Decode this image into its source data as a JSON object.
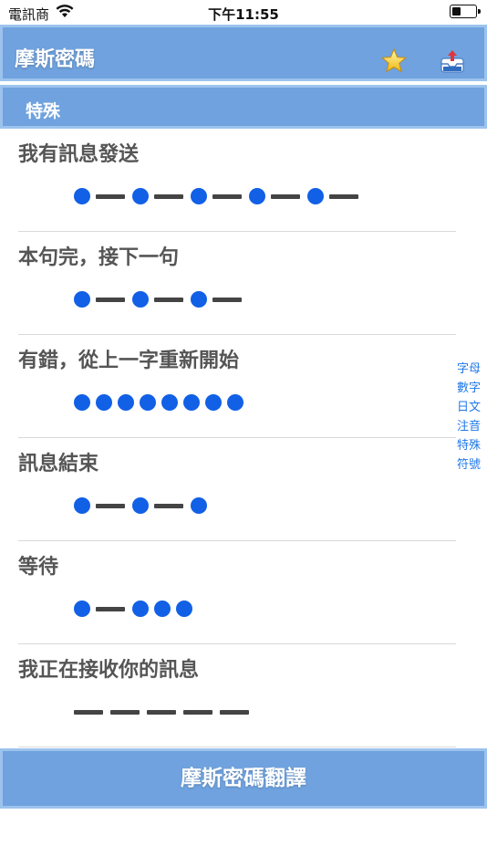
{
  "status_bar": {
    "carrier": "電訊商",
    "time": "下午11:55"
  },
  "nav": {
    "title": "摩斯密碼",
    "icons": [
      "star-icon",
      "inbox-icon"
    ]
  },
  "section": {
    "title": "特殊"
  },
  "rows": [
    {
      "label": "我有訊息發送",
      "code": ".-.-.-.-.-"
    },
    {
      "label": "本句完，接下一句",
      "code": ".-.-.-"
    },
    {
      "label": "有錯，從上一字重新開始",
      "code": "........"
    },
    {
      "label": "訊息結束",
      "code": ".-.-."
    },
    {
      "label": "等待",
      "code": ".-..."
    },
    {
      "label": "我正在接收你的訊息",
      "code": "-----"
    }
  ],
  "index": [
    "字母",
    "數字",
    "日文",
    "注音",
    "特殊",
    "符號"
  ],
  "bottom_button": {
    "label": "摩斯密碼翻譯"
  },
  "colors": {
    "bar_blue": "#6fa2de",
    "dot_blue": "#1160e6",
    "index_blue": "#1f78e8"
  }
}
